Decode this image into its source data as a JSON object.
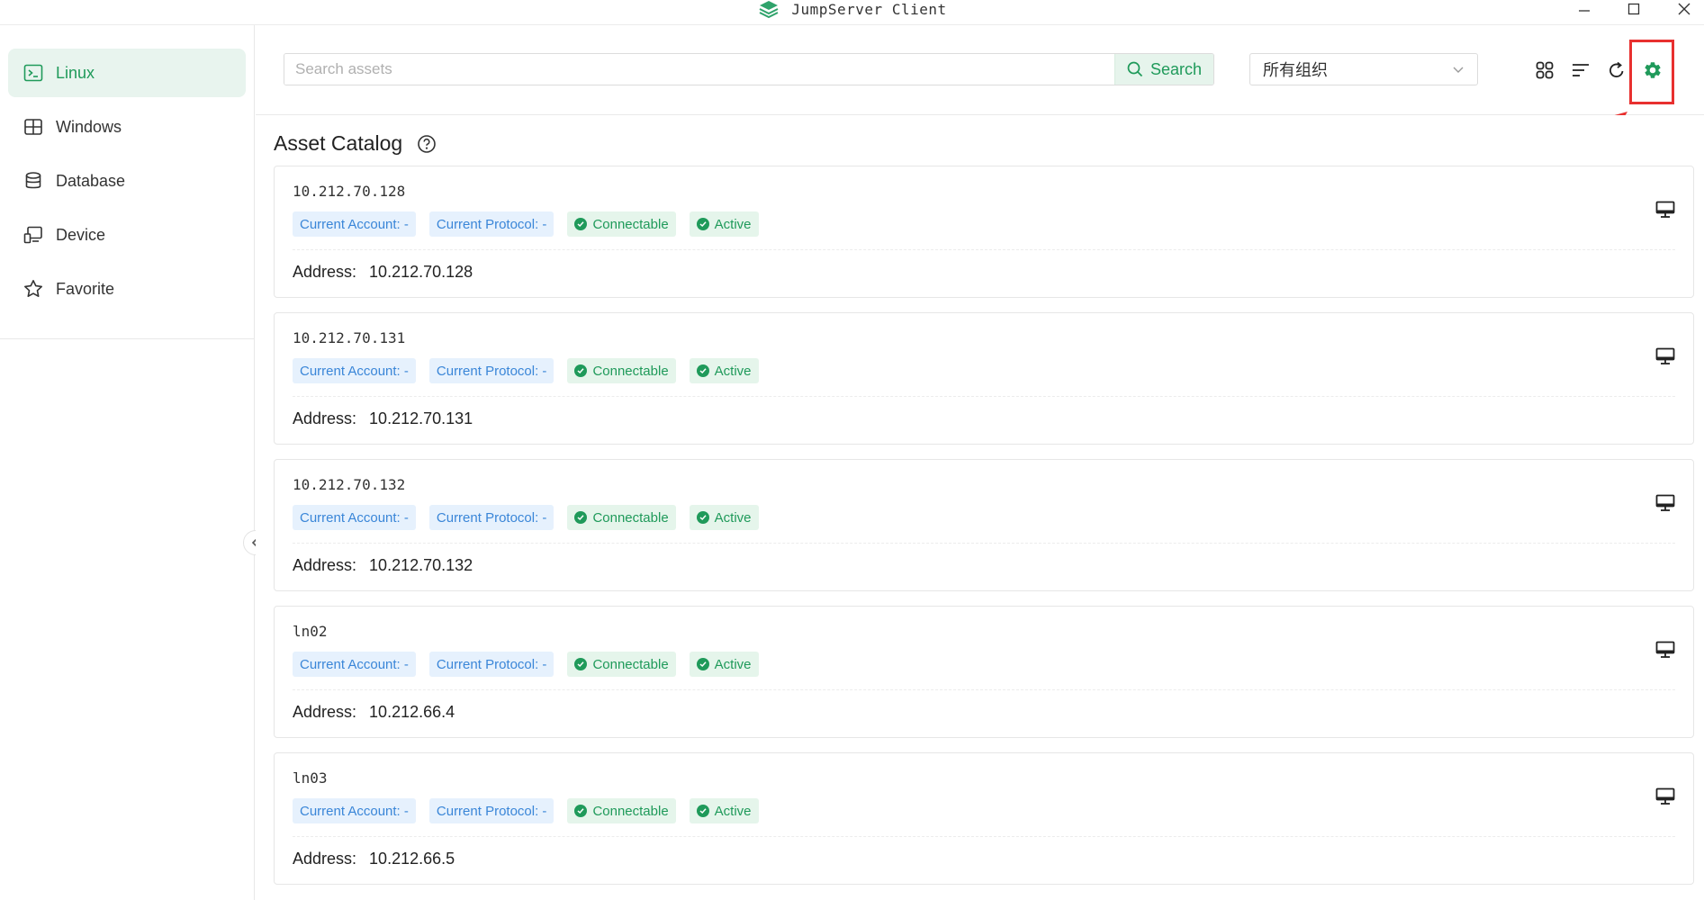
{
  "window": {
    "title": "JumpServer Client"
  },
  "sidebar": {
    "items": [
      {
        "label": "Linux",
        "icon": "terminal-icon",
        "active": true
      },
      {
        "label": "Windows",
        "icon": "windows-icon",
        "active": false
      },
      {
        "label": "Database",
        "icon": "database-icon",
        "active": false
      },
      {
        "label": "Device",
        "icon": "device-icon",
        "active": false
      },
      {
        "label": "Favorite",
        "icon": "star-icon",
        "active": false
      }
    ]
  },
  "toolbar": {
    "search_placeholder": "Search assets",
    "search_value": "",
    "search_button": "Search",
    "org_selected": "所有组织",
    "icons": [
      "grid-view-icon",
      "sort-icon",
      "refresh-icon",
      "settings-icon"
    ]
  },
  "main": {
    "title": "Asset Catalog",
    "address_label": "Address:",
    "account_tag": "Current Account: -",
    "protocol_tag": "Current Protocol: -",
    "connectable_tag": "Connectable",
    "active_tag": "Active",
    "assets": [
      {
        "name": "10.212.70.128",
        "address": "10.212.70.128"
      },
      {
        "name": "10.212.70.131",
        "address": "10.212.70.131"
      },
      {
        "name": "10.212.70.132",
        "address": "10.212.70.132"
      },
      {
        "name": "ln02",
        "address": "10.212.66.4"
      },
      {
        "name": "ln03",
        "address": "10.212.66.5"
      }
    ]
  },
  "colors": {
    "accent": "#1f9a5a",
    "accent_bg": "#e8f4ee",
    "info_blue": "#3a86d8",
    "info_blue_bg": "#e6f1fd",
    "annotation_red": "#e8302f"
  }
}
